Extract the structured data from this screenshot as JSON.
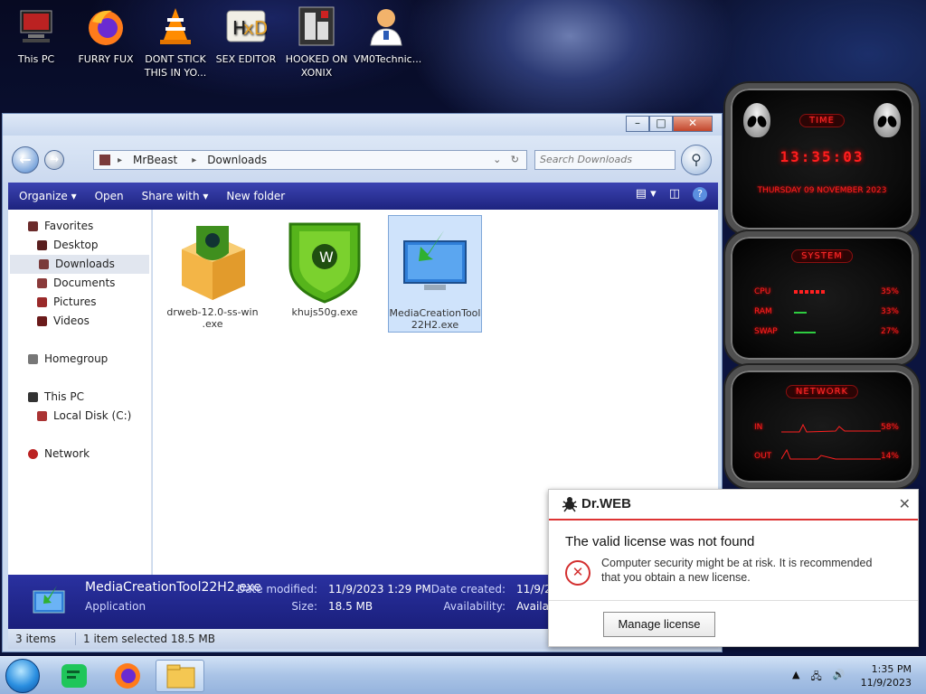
{
  "desktop": {
    "icons": [
      {
        "label": "This PC",
        "icon": "computer-icon"
      },
      {
        "label": "FURRY FUX",
        "icon": "firefox-icon"
      },
      {
        "label": "DONT STICK THIS IN YO...",
        "icon": "vlc-icon"
      },
      {
        "label": "SEX EDITOR",
        "icon": "hxd-icon"
      },
      {
        "label": "HOOKED ON XONIX",
        "icon": "game-icon"
      },
      {
        "label": "VM0Technic...",
        "icon": "doctor-icon"
      }
    ]
  },
  "explorer": {
    "breadcrumb": [
      "MrBeast",
      "Downloads"
    ],
    "search_placeholder": "Search Downloads",
    "toolbar": {
      "organize": "Organize",
      "open": "Open",
      "share_with": "Share with",
      "new_folder": "New folder"
    },
    "nav": {
      "favorites": "Favorites",
      "desktop": "Desktop",
      "downloads": "Downloads",
      "documents": "Documents",
      "pictures": "Pictures",
      "videos": "Videos",
      "homegroup": "Homegroup",
      "this_pc": "This PC",
      "local_disk": "Local Disk (C:)",
      "network": "Network"
    },
    "files": [
      {
        "name": "drweb-12.0-ss-win\n.exe",
        "line1": "drweb-12.0-ss-win",
        "line2": ".exe"
      },
      {
        "name": "khujs50g.exe",
        "line1": "khujs50g.exe",
        "line2": ""
      },
      {
        "name": "MediaCreationTool22H2.exe",
        "line1": "MediaCreationTool",
        "line2": "22H2.exe"
      }
    ],
    "details": {
      "name": "MediaCreationTool22H2.exe",
      "type": "Application",
      "date_modified_label": "Date modified:",
      "date_modified": "11/9/2023 1:29 PM",
      "size_label": "Size:",
      "size": "18.5 MB",
      "date_created_label": "Date created:",
      "date_created": "11/9/20",
      "availability_label": "Availability:",
      "availability": "Availa"
    },
    "status": {
      "items": "3 items",
      "selected": "1 item selected  18.5 MB"
    }
  },
  "gadget": {
    "time_title": "TIME",
    "time": "13:35:03",
    "date": "THURSDAY 09 NOVEMBER 2023",
    "system_title": "SYSTEM",
    "cpu_label": "CPU",
    "cpu_value": "35%",
    "ram_label": "RAM",
    "ram_value": "33%",
    "swap_label": "SWAP",
    "swap_value": "27%",
    "network_title": "NETWORK",
    "in_label": "IN",
    "in_value": "58%",
    "out_label": "OUT",
    "out_value": "14%"
  },
  "drweb": {
    "brand": "Dr.WEB",
    "title": "The valid license was not found",
    "message": "Computer security might be at risk. It is recommended that you obtain a new license.",
    "button": "Manage license"
  },
  "taskbar": {
    "time": "1:35 PM",
    "date": "11/9/2023"
  },
  "colors": {
    "toolbar": "#262c99",
    "alert_red": "#d32f2f",
    "gadget_red": "#ff1e1e"
  }
}
